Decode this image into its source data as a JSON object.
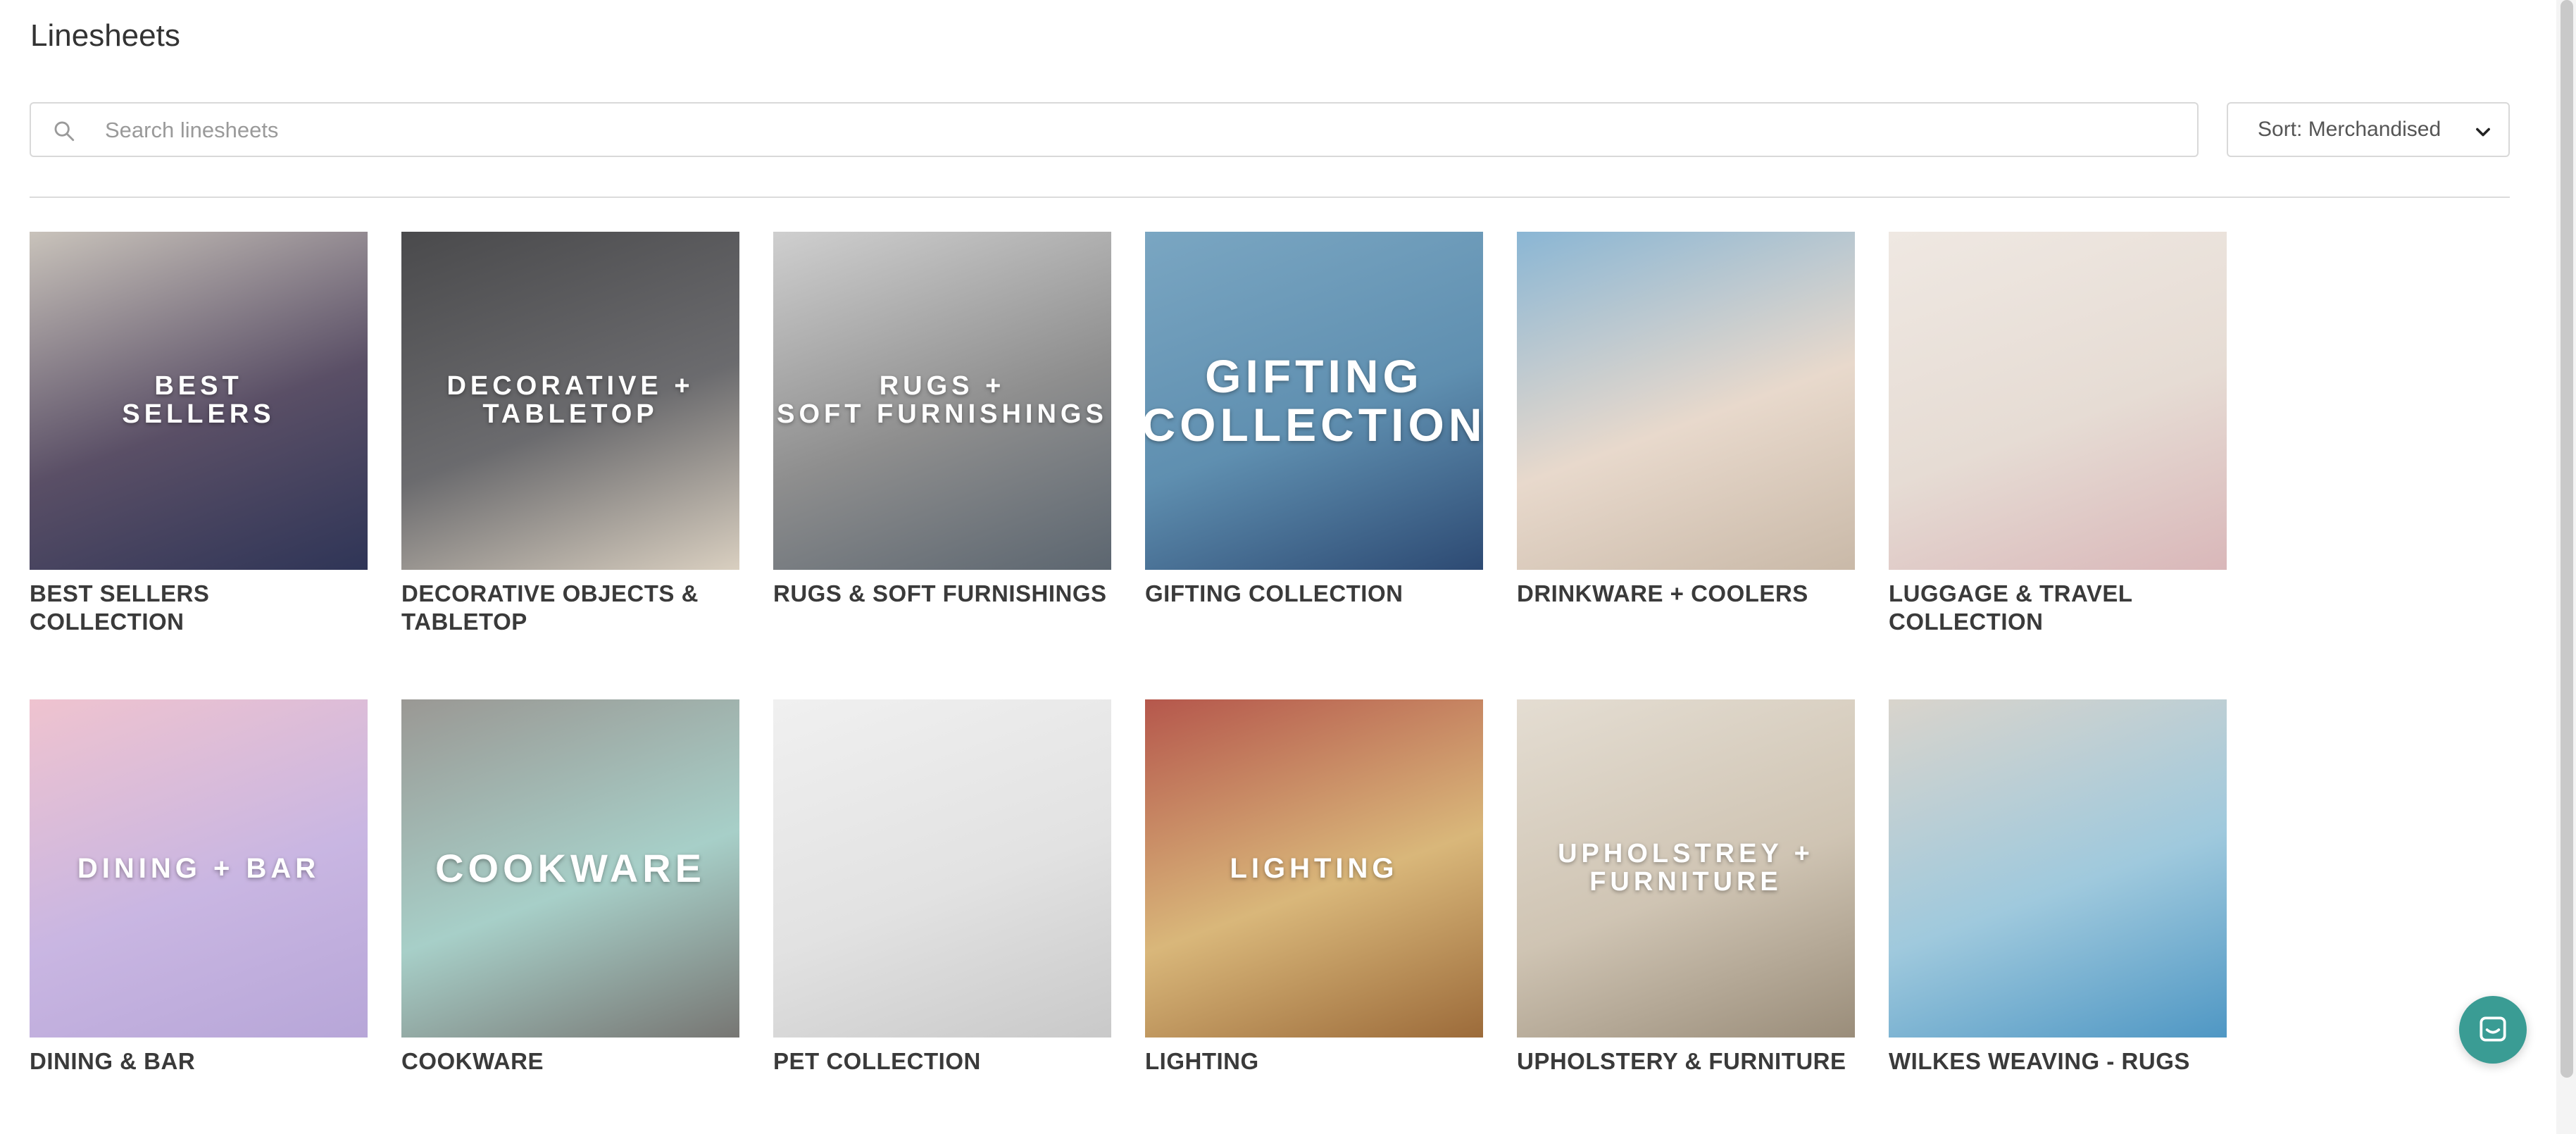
{
  "page": {
    "title": "Linesheets"
  },
  "search": {
    "placeholder": "Search linesheets",
    "value": ""
  },
  "sort": {
    "label": "Sort: Merchandised"
  },
  "cards": [
    {
      "name": "BEST SELLERS COLLECTION",
      "overlay": "BEST\nSELLERS",
      "colors": [
        "#c9c3bb",
        "#5a4f66",
        "#2f3557"
      ]
    },
    {
      "name": "DECORATIVE OBJECTS & TABLETOP",
      "overlay": "DECORATIVE +\nTABLETOP",
      "colors": [
        "#4a4a4c",
        "#6b6b6e",
        "#d9cfc0"
      ]
    },
    {
      "name": "RUGS & SOFT FURNISHINGS",
      "overlay": "RUGS +\nSOFT FURNISHINGS",
      "colors": [
        "#cfcfcf",
        "#8e8e8e",
        "#5c6670"
      ]
    },
    {
      "name": "GIFTING COLLECTION",
      "overlay": "GIFTING\nCOLLECTION",
      "colors": [
        "#7aa6c2",
        "#5f8fb0",
        "#2d4a73"
      ]
    },
    {
      "name": "DRINKWARE + COOLERS",
      "overlay": "",
      "colors": [
        "#8ab6d4",
        "#e8d9cc",
        "#c9b9a8"
      ]
    },
    {
      "name": "LUGGAGE & TRAVEL COLLECTION",
      "overlay": "",
      "colors": [
        "#efe8e2",
        "#e6dcd4",
        "#d9b7b9"
      ]
    },
    {
      "name": "DINING & BAR",
      "overlay": "DINING + BAR",
      "colors": [
        "#efc3cf",
        "#c9b6e2",
        "#b7a6d8"
      ]
    },
    {
      "name": "COOKWARE",
      "overlay": "COOKWARE",
      "colors": [
        "#9a9894",
        "#a7cfc8",
        "#777673"
      ]
    },
    {
      "name": "PET COLLECTION",
      "overlay": "",
      "colors": [
        "#f0f0f0",
        "#e2e2e2",
        "#c9c9c9"
      ]
    },
    {
      "name": "LIGHTING",
      "overlay": "LIGHTING",
      "colors": [
        "#b5574c",
        "#d9b77a",
        "#9c6b3a"
      ]
    },
    {
      "name": "UPHOLSTERY & FURNITURE",
      "overlay": "UPHOLSTREY +\nFURNITURE",
      "colors": [
        "#e4ddd2",
        "#cfc4b3",
        "#9a8d7a"
      ]
    },
    {
      "name": "WILKES WEAVING - RUGS",
      "overlay": "",
      "colors": [
        "#d9d4cc",
        "#9fc9dd",
        "#4f97c4"
      ]
    }
  ]
}
